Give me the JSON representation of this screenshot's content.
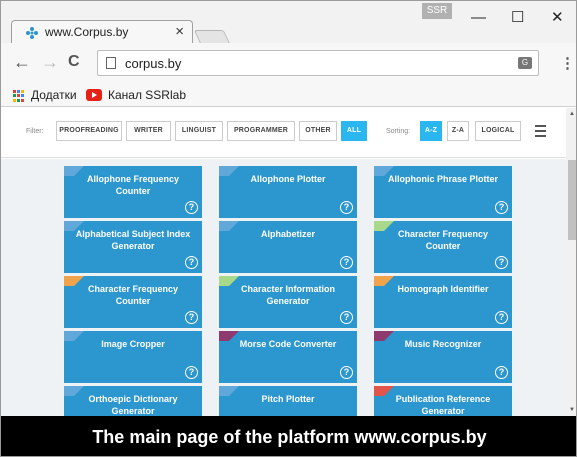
{
  "tab": {
    "title": "www.Corpus.by",
    "close": "×"
  },
  "window": {
    "profile_label": "SSR",
    "minimize": "—",
    "maximize": "☐",
    "close": "✕"
  },
  "toolbar": {
    "back": "←",
    "forward": "→",
    "reload": "C",
    "url": "corpus.by",
    "translate": "G",
    "menu": "⋮"
  },
  "bookmarks": {
    "apps_label": "Додатки",
    "channel_label": "Канал SSRlab"
  },
  "filters": {
    "filter_label": "Filter:",
    "buttons": [
      "PROOFREADING",
      "WRITER",
      "LINGUIST",
      "PROGRAMMER",
      "OTHER",
      "ALL"
    ],
    "active": "ALL",
    "sorting_label": "Sorting:",
    "sort_buttons": [
      "A-Z",
      "Z-A",
      "LOGICAL"
    ],
    "sort_active": "A-Z"
  },
  "tiles": [
    {
      "title": "Allophone Frequency Counter",
      "corner": "#5fa8d9"
    },
    {
      "title": "Allophone Plotter",
      "corner": "#5fa8d9"
    },
    {
      "title": "Allophonic Phrase Plotter",
      "corner": "#5fa8d9"
    },
    {
      "title": "Alphabetical Subject Index Generator",
      "corner": "#5fa8d9"
    },
    {
      "title": "Alphabetizer",
      "corner": "#5fa8d9"
    },
    {
      "title": "Character Frequency Counter",
      "corner": "#a8d88a"
    },
    {
      "title": "Character Frequency Counter",
      "corner": "#f0a34a"
    },
    {
      "title": "Character Information Generator",
      "corner": "#a8d88a"
    },
    {
      "title": "Homograph Identifier",
      "corner": "#f0a34a"
    },
    {
      "title": "Image Cropper",
      "corner": "#5fa8d9"
    },
    {
      "title": "Morse Code Converter",
      "corner": "#8e3a6e"
    },
    {
      "title": "Music Recognizer",
      "corner": "#8e3a6e"
    },
    {
      "title": "Orthoepic Dictionary Generator",
      "corner": "#5fa8d9"
    },
    {
      "title": "Pitch Plotter",
      "corner": "#5fa8d9"
    },
    {
      "title": "Publication Reference Generator",
      "corner": "#e2554a"
    }
  ],
  "help_glyph": "?",
  "caption": "The main page of the platform www.corpus.by"
}
